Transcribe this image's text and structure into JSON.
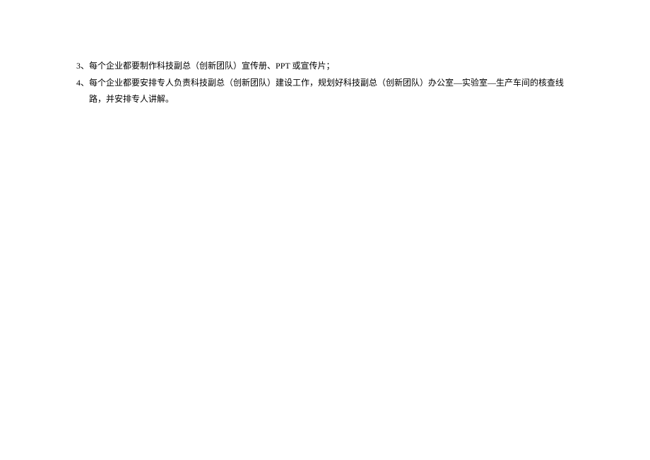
{
  "items": [
    {
      "number": "3、",
      "text": "每个企业都要制作科技副总（创新团队）宣传册、PPT 或宣传片；"
    },
    {
      "number": "4、",
      "text": "每个企业都要安排专人负责科技副总（创新团队）建设工作，规划好科技副总（创新团队）办公室—实验室—生产车间的核查线路，并安排专人讲解。"
    }
  ]
}
